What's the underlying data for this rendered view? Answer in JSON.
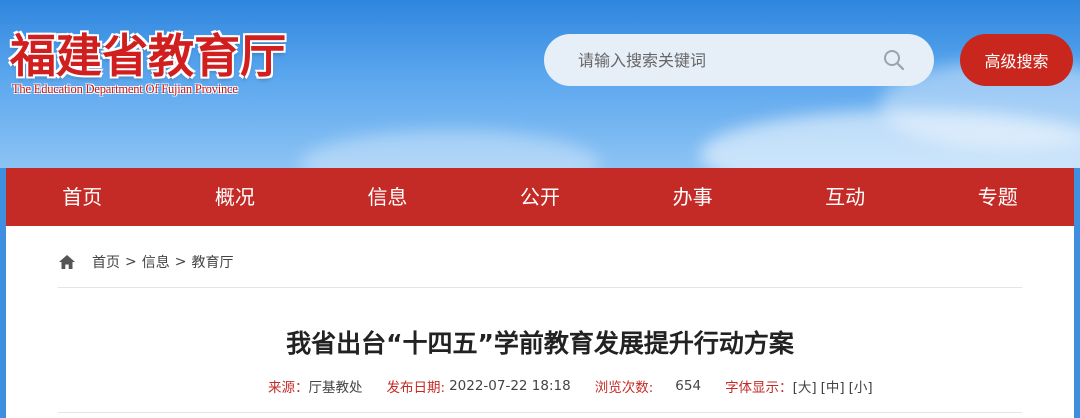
{
  "header": {
    "logo_cn": "福建省教育厅",
    "logo_en": "The Education Department Of Fujian Province",
    "search_placeholder": "请输入搜索关键词",
    "advanced_search_label": "高级搜索"
  },
  "nav": {
    "items": [
      "首页",
      "概况",
      "信息",
      "公开",
      "办事",
      "互动",
      "专题"
    ]
  },
  "breadcrumb": {
    "items": [
      "首页",
      "信息",
      "教育厅"
    ],
    "separator": ">"
  },
  "article": {
    "title": "我省出台“十四五”学前教育发展提升行动方案",
    "source_label": "来源：",
    "source_value": "厅基教处",
    "date_label": "发布日期:",
    "date_value": "2022-07-22 18:18",
    "views_label": "浏览次数:",
    "views_value": "654",
    "font_label": "字体显示：",
    "font_large": "[大]",
    "font_medium": "[中]",
    "font_small": "[小]"
  },
  "colors": {
    "brand_red": "#c42b26",
    "banner_blue": "#2f86de",
    "search_bg": "#e6eef7"
  },
  "icons": [
    "search-icon",
    "home-icon"
  ]
}
